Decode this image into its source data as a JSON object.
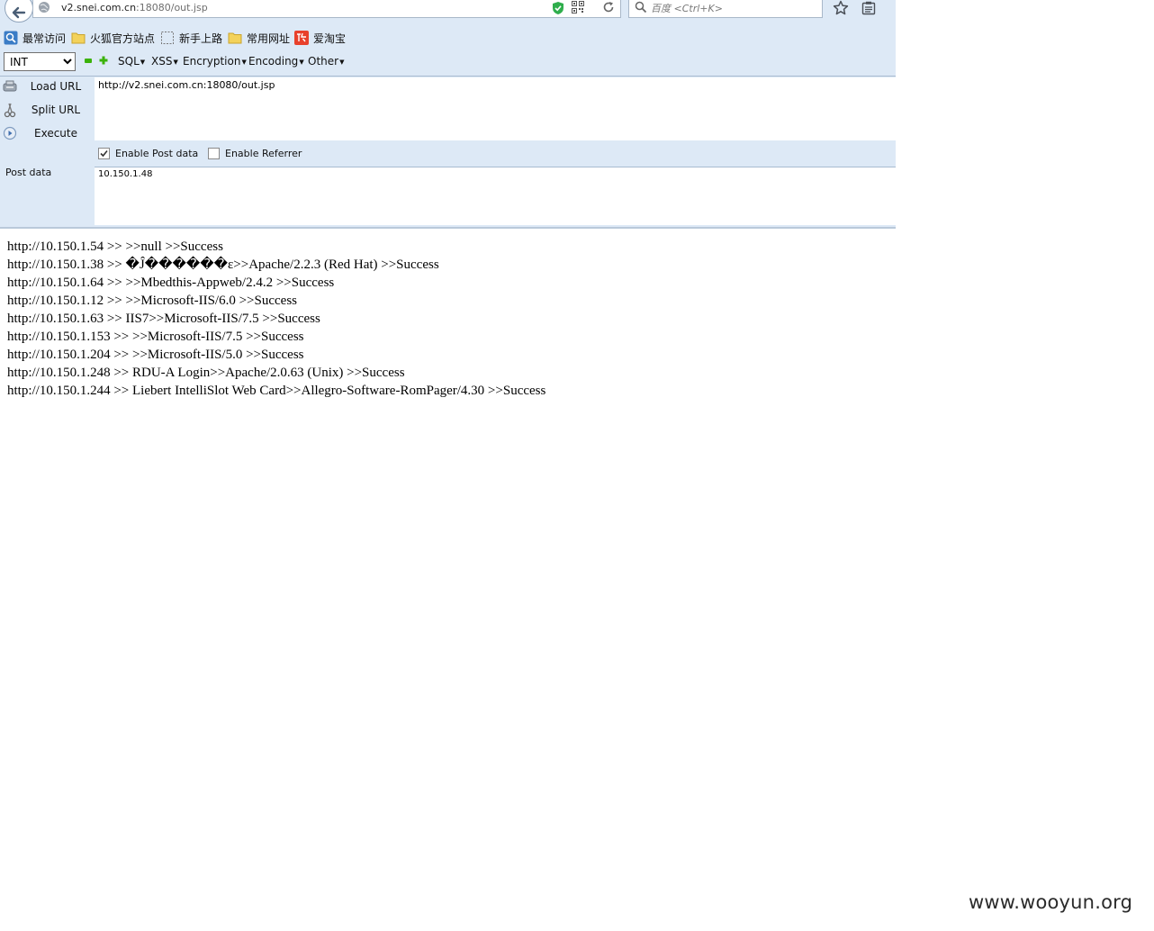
{
  "navbar": {
    "url_host": "v2.snei.com.cn",
    "url_rest": ":18080/out.jsp",
    "search_placeholder": "百度 <Ctrl+K>"
  },
  "bookmarks": [
    {
      "label": "最常访问",
      "icon": "magnifier-icon"
    },
    {
      "label": "火狐官方站点",
      "icon": "folder-icon"
    },
    {
      "label": "新手上路",
      "icon": "dashed-square-icon"
    },
    {
      "label": "常用网址",
      "icon": "folder-icon"
    },
    {
      "label": "爱淘宝",
      "icon": "taobao-icon"
    }
  ],
  "hackbar": {
    "type_select": {
      "value": "INT",
      "options": [
        "INT"
      ]
    },
    "menus": [
      "SQL",
      "XSS",
      "Encryption",
      "Encoding",
      "Other"
    ],
    "load_url": "Load URL",
    "split_url": "Split URL",
    "execute": "Execute",
    "url_value": "http://v2.snei.com.cn:18080/out.jsp",
    "enable_post": {
      "label": "Enable Post data",
      "checked": true
    },
    "enable_referrer": {
      "label": "Enable Referrer",
      "checked": false
    },
    "post_label": "Post data",
    "post_value": "10.150.1.48"
  },
  "results": [
    "http://10.150.1.54 >> >>null >>Success",
    "http://10.150.1.38 >> �Ĵ������ε>>Apache/2.2.3 (Red Hat) >>Success",
    "http://10.150.1.64 >> >>Mbedthis-Appweb/2.4.2 >>Success",
    "http://10.150.1.12 >> >>Microsoft-IIS/6.0 >>Success",
    "http://10.150.1.63 >> IIS7>>Microsoft-IIS/7.5 >>Success",
    "http://10.150.1.153 >> >>Microsoft-IIS/7.5 >>Success",
    "http://10.150.1.204 >> >>Microsoft-IIS/5.0 >>Success",
    "http://10.150.1.248 >> RDU-A Login>>Apache/2.0.63 (Unix) >>Success",
    "http://10.150.1.244 >> Liebert IntelliSlot Web Card>>Allegro-Software-RomPager/4.30 >>Success"
  ],
  "watermark": "www.wooyun.org",
  "colors": {
    "chrome_bg": "#dde9f6",
    "accent_green": "#3bb20a",
    "taobao_red": "#e8412c"
  }
}
